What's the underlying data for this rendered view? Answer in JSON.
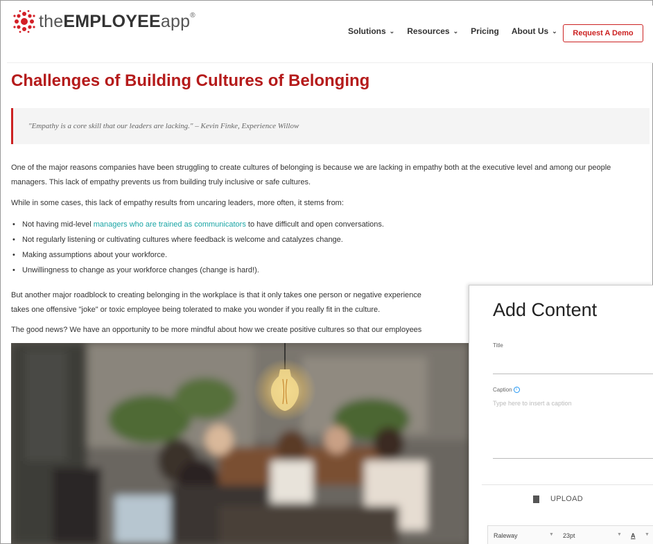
{
  "header": {
    "logo_prefix": "the",
    "logo_bold": "EMPLOYEE",
    "logo_suffix": "app",
    "logo_reg": "®",
    "nav": [
      {
        "label": "Solutions",
        "has_dropdown": true
      },
      {
        "label": "Resources",
        "has_dropdown": true
      },
      {
        "label": "Pricing",
        "has_dropdown": false
      },
      {
        "label": "About Us",
        "has_dropdown": true
      }
    ],
    "cta_label": "Request A Demo",
    "accent_color": "#c62828"
  },
  "article": {
    "title": "Challenges of Building Cultures of Belonging",
    "quote": "\"Empathy is a core skill that our leaders are lacking.\" – Kevin Finke, Experience Willow",
    "p1": "One of the major reasons companies have been struggling to create cultures of belonging is because we are lacking in empathy both at the executive level and among our people managers. This lack of empathy prevents us from building truly inclusive or safe cultures.",
    "p2": "While in some cases, this lack of empathy results from uncaring leaders, more often, it stems from:",
    "bullets": [
      {
        "before": "Not having mid-level ",
        "link": "managers who are trained as communicators",
        "after": " to have difficult and open conversations."
      },
      {
        "text": "Not regularly listening or cultivating cultures where feedback is welcome and catalyzes change."
      },
      {
        "text": "Making assumptions about your workforce."
      },
      {
        "text": "Unwillingness to change as your workforce changes (change is hard!)."
      }
    ],
    "p3_line1": "But another major roadblock to creating belonging in the workplace is that it only takes one person or negative experience",
    "p3_line2": "takes one offensive \"joke\" or toxic employee being tolerated to make you wonder if you really fit in the culture.",
    "p4": "The good news? We have an opportunity to be more mindful about how we create positive cultures so that our employees",
    "link_color": "#1aa5a5"
  },
  "panel": {
    "title": "Add Content",
    "title_label": "Title",
    "caption_label": "Caption",
    "caption_placeholder": "Type here to insert a caption",
    "upload_label": "UPLOAD",
    "font_family": "Raleway",
    "font_size": "23pt",
    "text_color_label": "A"
  }
}
